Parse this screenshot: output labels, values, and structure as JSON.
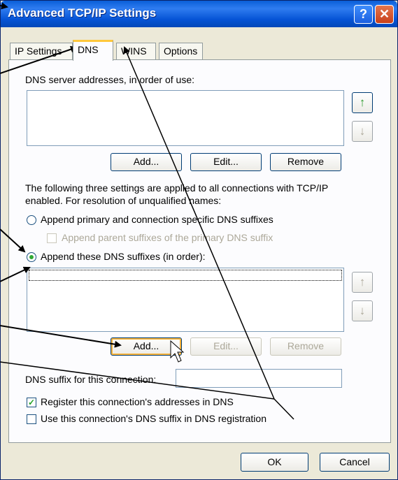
{
  "window": {
    "title": "Advanced TCP/IP Settings",
    "help_label": "?",
    "close_label": "✕"
  },
  "tabs": [
    {
      "label": "IP Settings",
      "active": false
    },
    {
      "label": "DNS",
      "active": true
    },
    {
      "label": "WINS",
      "active": false
    },
    {
      "label": "Options",
      "active": false
    }
  ],
  "dns_servers": {
    "label": "DNS server addresses, in order of use:",
    "items": [],
    "add_label": "Add...",
    "edit_label": "Edit...",
    "remove_label": "Remove"
  },
  "resolution": {
    "description": "The following three settings are applied to all connections with TCP/IP",
    "description2": "enabled. For resolution of unqualified names:",
    "option_primary": "Append primary and connection specific DNS suffixes",
    "option_parent": "Append parent suffixes of the primary DNS suffix",
    "option_these": "Append these DNS suffixes (in order):"
  },
  "suffixes": {
    "items": [],
    "add_label": "Add...",
    "edit_label": "Edit...",
    "remove_label": "Remove"
  },
  "connection_suffix": {
    "label": "DNS suffix for this connection:",
    "value": ""
  },
  "register": {
    "register_label": "Register this connection's addresses in DNS",
    "register_checked": true,
    "use_suffix_label": "Use this connection's DNS suffix in DNS registration",
    "use_suffix_checked": false
  },
  "footer": {
    "ok_label": "OK",
    "cancel_label": "Cancel"
  },
  "colors": {
    "titlebar": "#0a5fd8",
    "window_bg": "#ece9d8",
    "up_arrow_green": "#2e9a2e",
    "focus_orange": "#f8b33a"
  },
  "icons": {
    "up_arrow": "arrow-up-icon",
    "down_arrow": "arrow-down-icon",
    "cursor": "mouse-pointer-icon"
  }
}
